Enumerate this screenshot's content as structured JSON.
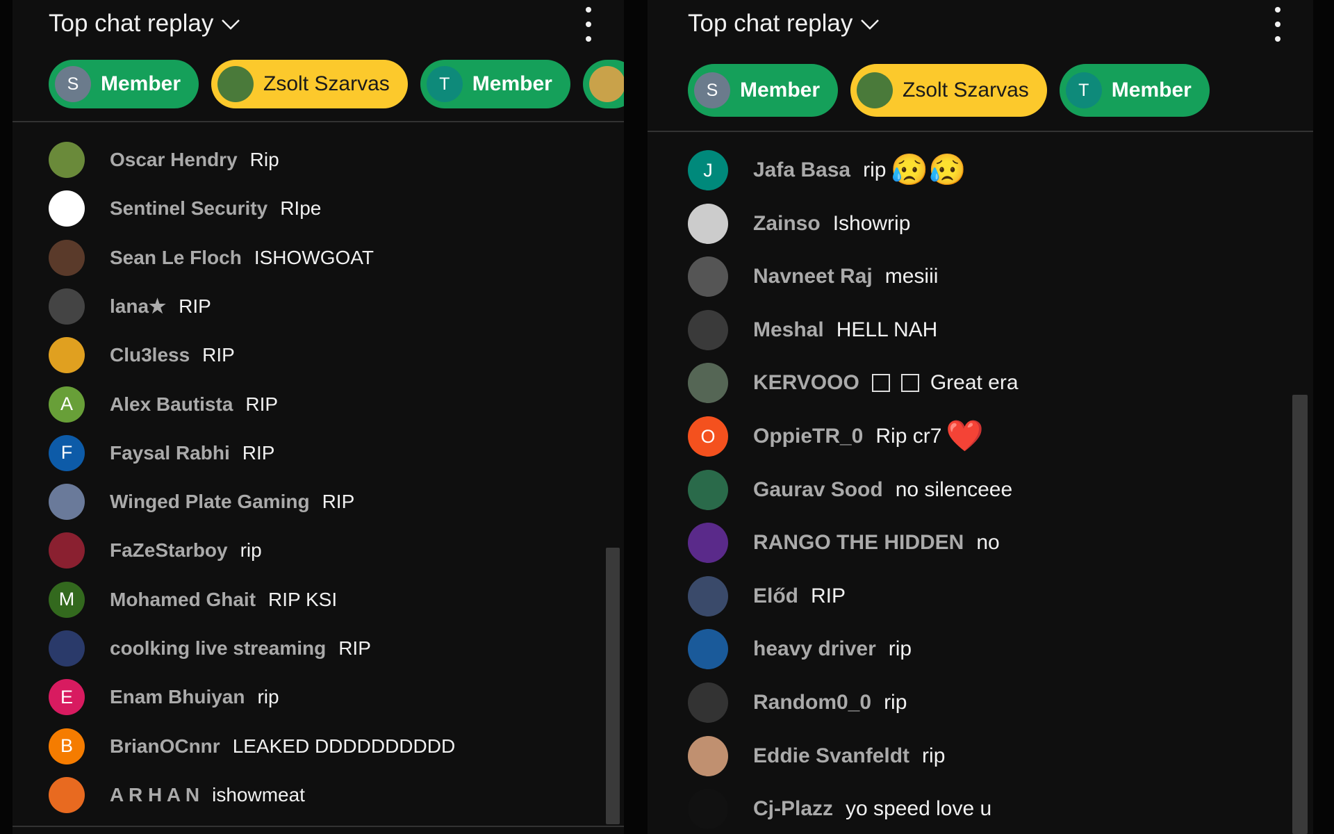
{
  "left": {
    "title": "Top chat replay",
    "chips": [
      {
        "initial": "S",
        "label": "Member",
        "style": "member",
        "avatar_color": "#6b7b8c"
      },
      {
        "initial": "",
        "label": "Zsolt Szarvas",
        "style": "gold",
        "avatar_color": "#4a7a3a"
      },
      {
        "initial": "T",
        "label": "Member",
        "style": "member",
        "avatar_color": "#0e8a7a"
      },
      {
        "initial": "",
        "label": "",
        "style": "member",
        "avatar_color": "#c9a24a"
      }
    ],
    "messages": [
      {
        "author": "Oscar Hendry",
        "text": "Rip",
        "initial": "",
        "color": "#6a8a3a"
      },
      {
        "author": "Sentinel Security",
        "text": "RIpe",
        "initial": "",
        "color": "#ffffff"
      },
      {
        "author": "Sean Le Floch",
        "text": "ISHOWGOAT",
        "initial": "",
        "color": "#5a3a2a"
      },
      {
        "author": "lana★",
        "text": "RIP",
        "initial": "",
        "color": "#444444"
      },
      {
        "author": "Clu3less",
        "text": "RIP",
        "initial": "",
        "color": "#e0a020"
      },
      {
        "author": "Alex Bautista",
        "text": "RIP",
        "initial": "A",
        "color": "#689f38"
      },
      {
        "author": "Faysal Rabhi",
        "text": "RIP",
        "initial": "F",
        "color": "#0d5ba8"
      },
      {
        "author": "Winged Plate Gaming",
        "text": "RIP",
        "initial": "",
        "color": "#6a7a9a"
      },
      {
        "author": "FaZeStarboy",
        "text": "rip",
        "initial": "",
        "color": "#8a2030"
      },
      {
        "author": "Mohamed Ghait",
        "text": "RIP KSI",
        "initial": "M",
        "color": "#33691e"
      },
      {
        "author": "coolking live streaming",
        "text": "RIP",
        "initial": "",
        "color": "#2a3a6a"
      },
      {
        "author": "Enam Bhuiyan",
        "text": "rip",
        "initial": "E",
        "color": "#d81b60"
      },
      {
        "author": "BrianOCnnr",
        "text": "LEAKED DDDDDDDDDD",
        "initial": "B",
        "color": "#f57c00"
      },
      {
        "author": "A R H A N",
        "text": "ishowmeat",
        "initial": "",
        "color": "#e86a20"
      }
    ]
  },
  "right": {
    "title": "Top chat replay",
    "chips": [
      {
        "initial": "S",
        "label": "Member",
        "style": "member",
        "avatar_color": "#6b7b8c"
      },
      {
        "initial": "",
        "label": "Zsolt Szarvas",
        "style": "gold",
        "avatar_color": "#4a7a3a"
      },
      {
        "initial": "T",
        "label": "Member",
        "style": "member",
        "avatar_color": "#0e8a7a"
      }
    ],
    "messages": [
      {
        "author": "Jafa Basa",
        "text": "rip",
        "initial": "J",
        "color": "#00897b",
        "emoji": "😥😥"
      },
      {
        "author": "Zainso",
        "text": "Ishowrip",
        "initial": "",
        "color": "#cccccc"
      },
      {
        "author": "Navneet Raj",
        "text": "mesiii",
        "initial": "",
        "color": "#555555"
      },
      {
        "author": "Meshal",
        "text": "HELL NAH",
        "initial": "",
        "color": "#3a3a3a"
      },
      {
        "author": "KERVOOO",
        "text": "Great era",
        "initial": "",
        "color": "#556655",
        "boxes": 2
      },
      {
        "author": "OppieTR_0",
        "text": "Rip cr7",
        "initial": "O",
        "color": "#f4511e",
        "emoji": "❤️"
      },
      {
        "author": "Gaurav Sood",
        "text": "no silenceee",
        "initial": "",
        "color": "#2a6a4a"
      },
      {
        "author": "RANGO THE HIDDEN",
        "text": "no",
        "initial": "",
        "color": "#5a2a8a"
      },
      {
        "author": "Előd",
        "text": "RIP",
        "initial": "",
        "color": "#3a4a6a"
      },
      {
        "author": "heavy driver",
        "text": "rip",
        "initial": "",
        "color": "#1a5a9a"
      },
      {
        "author": "Random0_0",
        "text": "rip",
        "initial": "",
        "color": "#333333"
      },
      {
        "author": "Eddie Svanfeldt",
        "text": "rip",
        "initial": "",
        "color": "#c09070"
      },
      {
        "author": "Cj-Plazz",
        "text": "yo speed love u",
        "initial": "",
        "color": "#111111"
      }
    ]
  }
}
